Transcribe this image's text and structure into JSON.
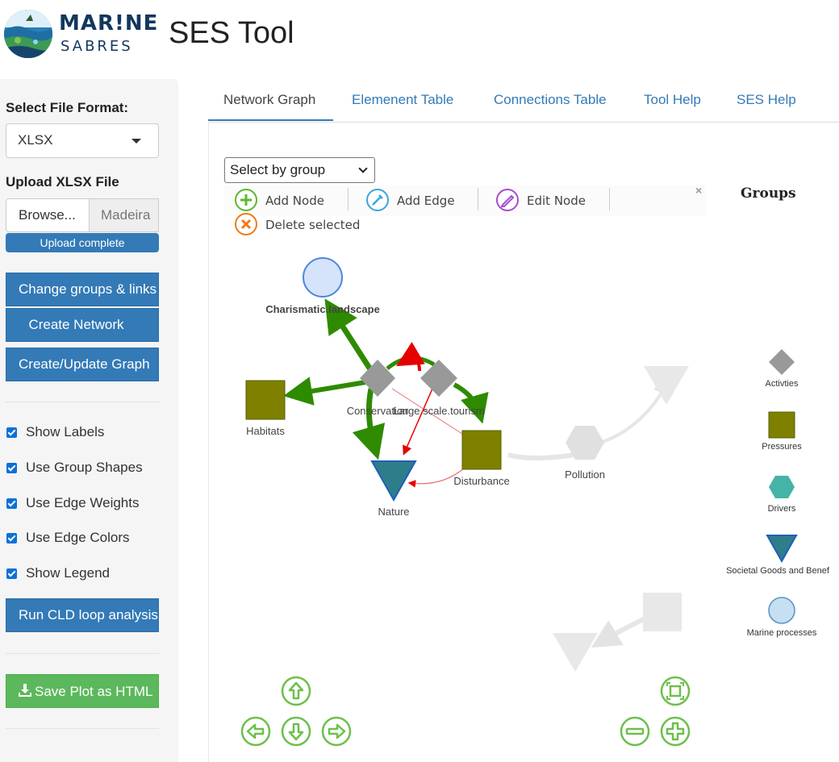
{
  "header": {
    "brand_line1": "MAR!NE",
    "brand_line2": "SABRES",
    "app_title": "SES Tool"
  },
  "sidebar": {
    "file_format_label": "Select File Format:",
    "file_format_value": "XLSX",
    "upload_label": "Upload XLSX File",
    "browse_label": "Browse...",
    "file_name": "Madeira",
    "upload_status": "Upload complete",
    "buttons": {
      "change_groups": "Change groups & links",
      "create_network": "Create Network",
      "create_update_graph": "Create/Update Graph",
      "run_cld": "Run CLD loop analysis",
      "save_plot": "Save Plot as HTML"
    },
    "checkboxes": [
      {
        "label": "Show Labels",
        "checked": true
      },
      {
        "label": "Use Group Shapes",
        "checked": true
      },
      {
        "label": "Use Edge Weights",
        "checked": true
      },
      {
        "label": "Use Edge Colors",
        "checked": true
      },
      {
        "label": "Show Legend",
        "checked": true
      }
    ]
  },
  "tabs": [
    {
      "label": "Network Graph",
      "active": true
    },
    {
      "label": "Elemenent Table",
      "active": false
    },
    {
      "label": "Connections Table",
      "active": false
    },
    {
      "label": "Tool Help",
      "active": false
    },
    {
      "label": "SES Help",
      "active": false
    }
  ],
  "graph": {
    "group_select_placeholder": "Select by group",
    "toolbar": {
      "add_node": "Add Node",
      "add_edge": "Add Edge",
      "edit_node": "Edit Node",
      "delete_selected": "Delete selected",
      "close": "×"
    },
    "legend_title": "Groups",
    "legend": [
      {
        "label": "Activties",
        "shape": "diamond",
        "color": "#999999"
      },
      {
        "label": "Pressures",
        "shape": "square",
        "color": "#7f7f00"
      },
      {
        "label": "Drivers",
        "shape": "hexagon",
        "color": "#45b3a5"
      },
      {
        "label": "Societal Goods and Benef",
        "shape": "triangle",
        "color": "#2e7d8a"
      },
      {
        "label": "Marine processes",
        "shape": "circle",
        "color": "#c5e0f0"
      }
    ],
    "nodes": [
      {
        "label": "Charismatic.landscape",
        "group": "Marine processes"
      },
      {
        "label": "Habitats",
        "group": "Pressures"
      },
      {
        "label": "Conservation",
        "group": "Activties"
      },
      {
        "label": "Large.scale.tourism",
        "group": "Activties"
      },
      {
        "label": "Disturbance",
        "group": "Pressures"
      },
      {
        "label": "Nature",
        "group": "Societal Goods and Benef"
      },
      {
        "label": "Pollution",
        "group": "Drivers"
      }
    ],
    "colors": {
      "positive_edge": "#2e8b00",
      "negative_edge": "#e60000",
      "nav_button": "#6cc04a"
    }
  }
}
